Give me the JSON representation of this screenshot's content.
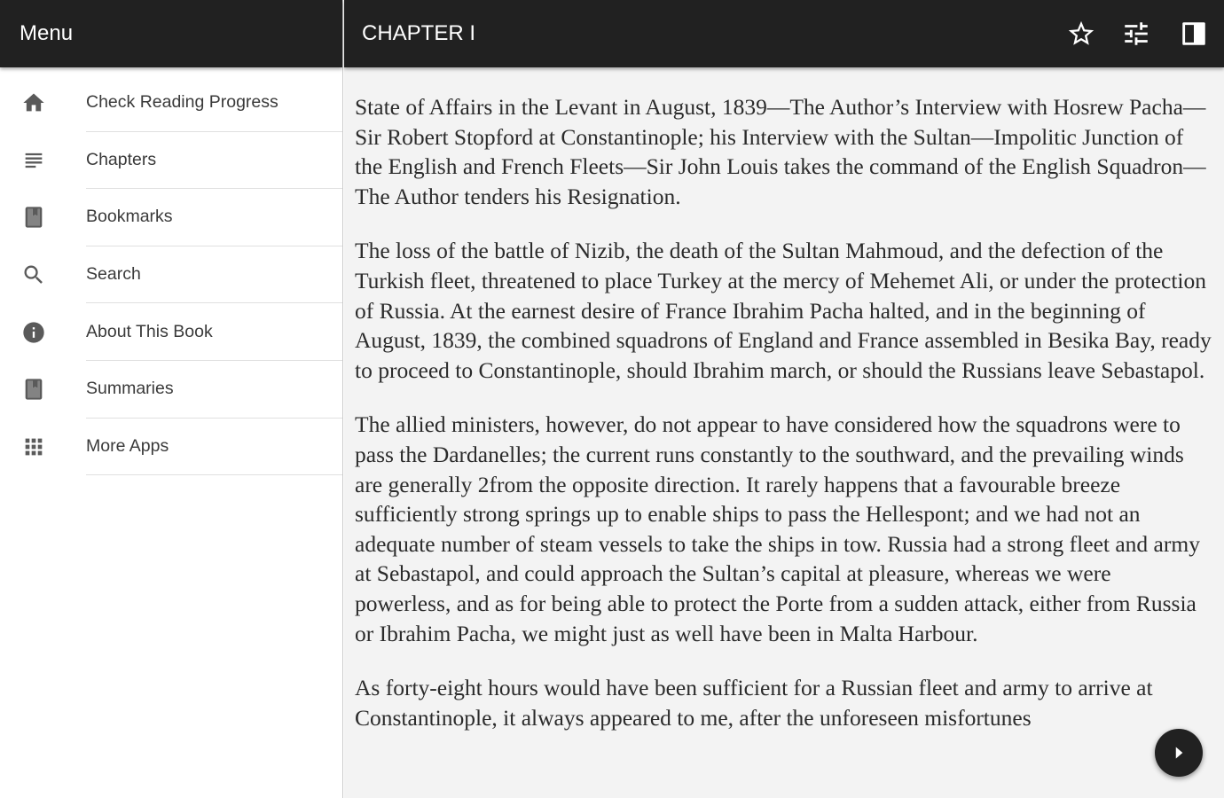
{
  "drawer": {
    "title": "Menu",
    "items": [
      {
        "label": "Check Reading Progress",
        "icon": "home-icon"
      },
      {
        "label": "Chapters",
        "icon": "list-icon"
      },
      {
        "label": "Bookmarks",
        "icon": "book-icon"
      },
      {
        "label": "Search",
        "icon": "search-icon"
      },
      {
        "label": "About This Book",
        "icon": "info-icon"
      },
      {
        "label": "Summaries",
        "icon": "book-icon"
      },
      {
        "label": "More Apps",
        "icon": "apps-grid-icon"
      }
    ]
  },
  "toolbar": {
    "title": "CHAPTER I",
    "actions": [
      {
        "icon": "star-outline-icon"
      },
      {
        "icon": "tune-settings-icon"
      },
      {
        "icon": "contrast-toggle-icon"
      }
    ]
  },
  "content": {
    "paragraphs": [
      "State of Affairs in the Levant in August, 1839—The Author’s Interview with Hosrew Pacha—Sir Robert Stopford at Constantinople; his Interview with the Sultan—Impolitic Junction of the English and French Fleets—Sir John Louis takes the command of the English Squadron—The Author tenders his Resignation.",
      "The loss of the battle of Nizib, the death of the Sultan Mahmoud, and the defection of the Turkish fleet, threatened to place Turkey at the mercy of Mehemet Ali, or under the protection of Russia. At the earnest desire of France Ibrahim Pacha halted, and in the beginning of August, 1839, the combined squadrons of England and France assembled in Besika Bay, ready to proceed to Constantinople, should Ibrahim march, or should the Russians leave Sebastapol.",
      "The allied ministers, however, do not appear to have considered how the squadrons were to pass the Dardanelles; the current runs constantly to the southward, and the prevailing winds are generally 2from the opposite direction. It rarely happens that a favourable breeze sufficiently strong springs up to enable ships to pass the Hellespont; and we had not an adequate number of steam vessels to take the ships in tow. Russia had a strong fleet and army at Sebastapol, and could approach the Sultan’s capital at pleasure, whereas we were powerless, and as for being able to protect the Porte from a sudden attack, either from Russia or Ibrahim Pacha, we might just as well have been in Malta Harbour.",
      "As forty-eight hours would have been sufficient for a Russian fleet and army to arrive at Constantinople, it always appeared to me, after the unforeseen misfortunes"
    ]
  },
  "fab": {
    "icon": "next-arrow-icon"
  }
}
